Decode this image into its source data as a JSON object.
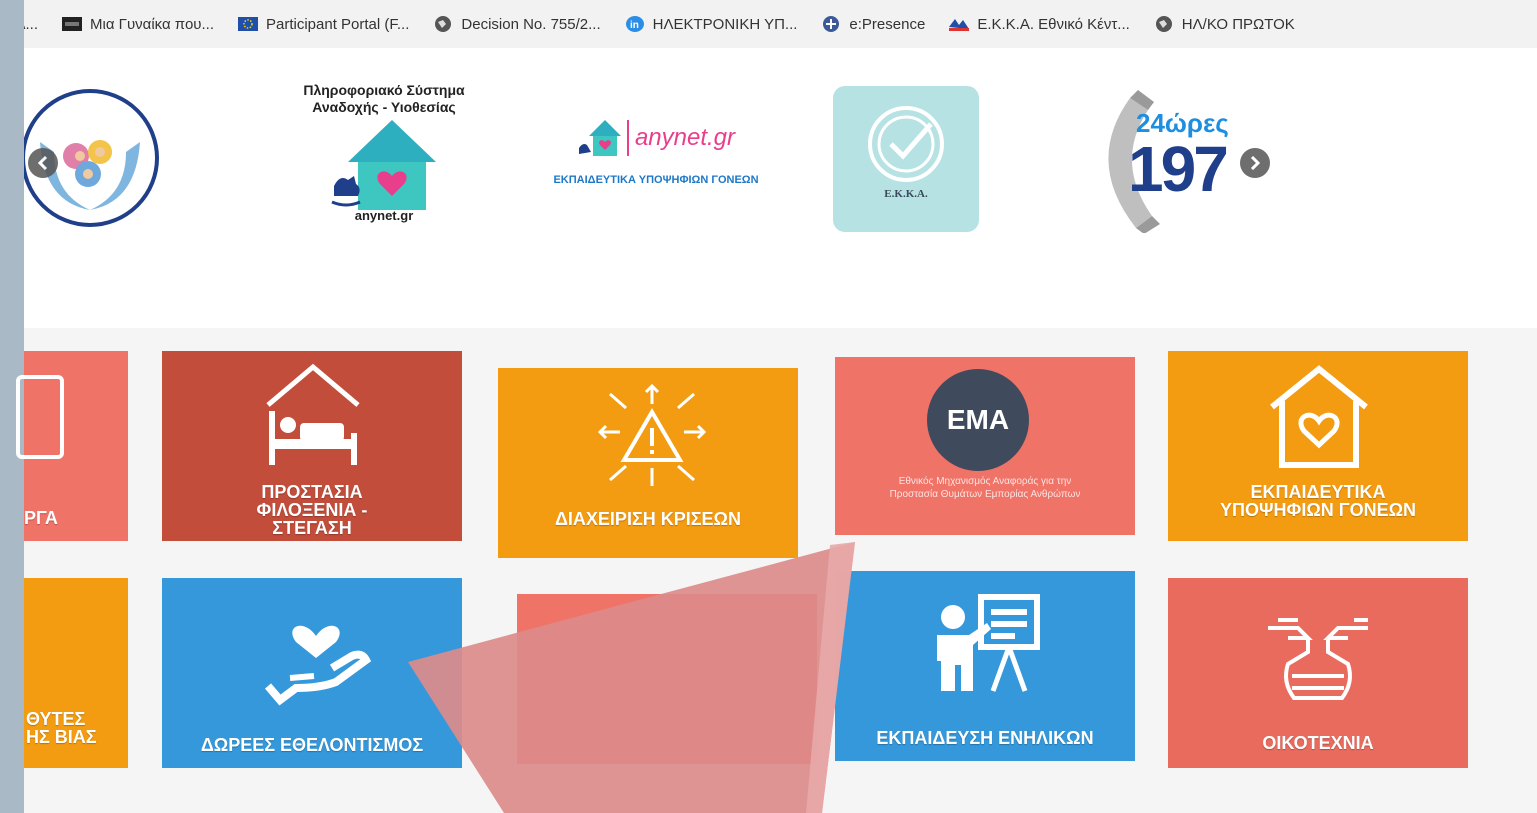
{
  "bookmarks": [
    {
      "label": "λ...",
      "icon": "bookmark-icon"
    },
    {
      "label": "Μια Γυναίκα που...",
      "icon": "video-icon"
    },
    {
      "label": "Participant Portal (F...",
      "icon": "eu-flag-icon"
    },
    {
      "label": "Decision No. 755/2...",
      "icon": "globe-icon"
    },
    {
      "label": "ΗΛΕΚΤΡΟΝΙΚΗ ΥΠ...",
      "icon": "linkedin-icon"
    },
    {
      "label": "e:Presence",
      "icon": "plus-circle-icon"
    },
    {
      "label": "Ε.Κ.Κ.Α. Εθνικό Κέντ...",
      "icon": "ekka-icon"
    },
    {
      "label": "ΗΛ/ΚΟ ΠΡΩΤΟΚ",
      "icon": "globe-icon"
    }
  ],
  "logos": {
    "adoption_title": "Πληροφοριακό Σύστημα Αναδοχής - Υιοθεσίας",
    "adoption_url": "anynet.gr",
    "anynet_name": "anynet.gr",
    "anynet_subtitle": "ΕΚΠΑΙΔΕΥΤΙΚΑ ΥΠΟΨΗΦΙΩΝ ΓΟΝΕΩΝ",
    "ekka_label": "E.K.K.A.",
    "hotline_top": "24ώρες",
    "hotline_number": "197"
  },
  "tiles": {
    "t1": "ΡΓΑ",
    "t2": "ΠΡΟΣΤΑΣΙΑ ΦΙΛΟΞΕΝΙΑ - ΣΤΕΓΑΣΗ",
    "t3": "ΔΙΑΧΕΙΡΙΣΗ ΚΡΙΣΕΩΝ",
    "t4_badge": "EMA",
    "t4_sub": "Εθνικός Μηχανισμός Αναφοράς για την Προστασία Θυμάτων Εμπορίας Ανθρώπων",
    "t5": "ΕΚΠΑΙΔΕΥΤΙΚΑ ΥΠΟΨΗΦΙΩΝ ΓΟΝΕΩΝ",
    "t6": "ΘΥΤΕΣ ΗΣ ΒΙΑΣ",
    "t7": "ΔΩΡΕΕΣ ΕΘΕΛΟΝΤΙΣΜΟΣ",
    "t9": "ΕΚΠΑΙΔΕΥΣΗ ΕΝΗΛΙΚΩΝ",
    "t10": "ΟΙΚΟΤΕΧΝΙΑ"
  },
  "colors": {
    "salmon": "#f07368",
    "brick": "#c24d3b",
    "orange": "#f39c12",
    "blue": "#3498db",
    "teal_logo": "#b6e2e3",
    "arrow": "#dc8b8b"
  }
}
